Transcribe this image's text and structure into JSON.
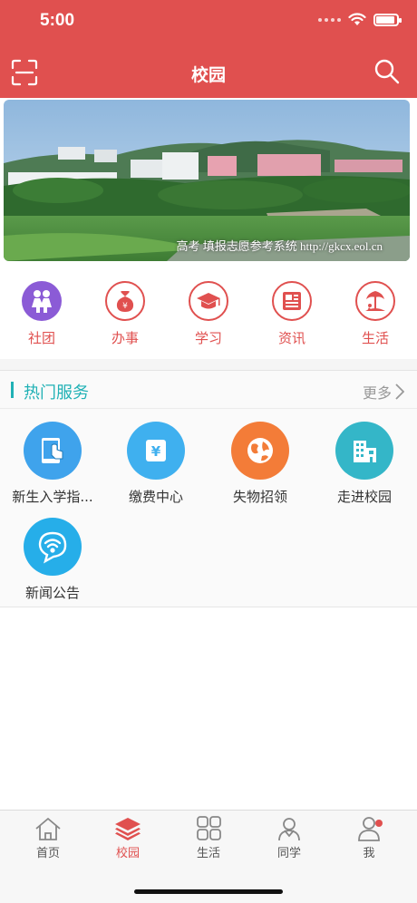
{
  "status_bar": {
    "time": "5:00"
  },
  "nav": {
    "title": "校园"
  },
  "banner": {
    "caption": "高考 填报志愿参考系统 http://gkcx.eol.cn"
  },
  "categories": [
    {
      "label": "社团",
      "icon": "club-icon",
      "color": "#8b5bd6"
    },
    {
      "label": "办事",
      "icon": "money-bag-icon",
      "color": "#e0504f"
    },
    {
      "label": "学习",
      "icon": "graduation-cap-icon",
      "color": "#e0504f"
    },
    {
      "label": "资讯",
      "icon": "newspaper-icon",
      "color": "#e0504f"
    },
    {
      "label": "生活",
      "icon": "beach-icon",
      "color": "#e0504f"
    }
  ],
  "services": {
    "title": "热门服务",
    "more": "更多",
    "items": [
      {
        "label": "新生入学指...",
        "icon": "tablet-hand-icon",
        "color": "#3fa3ec"
      },
      {
        "label": "缴费中心",
        "icon": "yuan-card-icon",
        "color": "#3fb0ef"
      },
      {
        "label": "失物招领",
        "icon": "globe-icon",
        "color": "#f37c38"
      },
      {
        "label": "走进校园",
        "icon": "building-icon",
        "color": "#34b6c8"
      },
      {
        "label": "新闻公告",
        "icon": "broadcast-icon",
        "color": "#26aee9"
      }
    ]
  },
  "tabbar": {
    "tabs": [
      {
        "label": "首页",
        "icon": "home-icon"
      },
      {
        "label": "校园",
        "icon": "layers-icon",
        "active": true
      },
      {
        "label": "生活",
        "icon": "grid-icon"
      },
      {
        "label": "同学",
        "icon": "classmates-icon"
      },
      {
        "label": "我",
        "icon": "user-icon",
        "badge": true
      }
    ]
  }
}
